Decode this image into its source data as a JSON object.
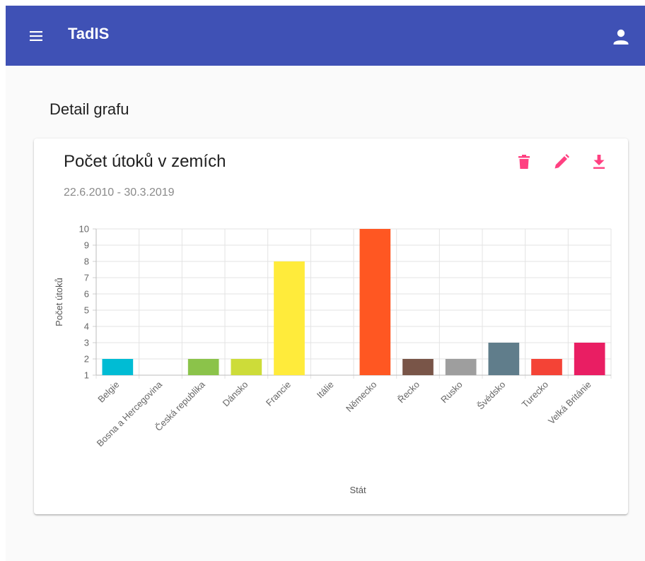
{
  "app": {
    "title": "TadIS",
    "menu_icon": "menu-icon",
    "account_icon": "account-icon",
    "accent_color": "#3f51b5"
  },
  "page": {
    "heading": "Detail grafu"
  },
  "card": {
    "title": "Počet útoků v zemích",
    "subtitle": "22.6.2010 - 30.3.2019",
    "actions": [
      {
        "name": "delete",
        "icon": "trash-icon"
      },
      {
        "name": "edit",
        "icon": "pencil-icon"
      },
      {
        "name": "download",
        "icon": "download-icon"
      }
    ],
    "action_color": "#ff4081"
  },
  "chart_data": {
    "type": "bar",
    "title": "",
    "xlabel": "Stát",
    "ylabel": "Počet útoků",
    "ylim": [
      1,
      10
    ],
    "yticks": [
      1,
      2,
      3,
      4,
      5,
      6,
      7,
      8,
      9,
      10
    ],
    "grid": true,
    "legend": "none",
    "categories": [
      "Belgie",
      "Bosna a Hercegovina",
      "Česká republika",
      "Dánsko",
      "Francie",
      "Itálie",
      "Německo",
      "Řecko",
      "Rusko",
      "Švédsko",
      "Turecko",
      "Velká Británie"
    ],
    "values": [
      2,
      1,
      2,
      2,
      8,
      1,
      10,
      2,
      2,
      3,
      2,
      3
    ],
    "colors": [
      "#00bcd4",
      "#ffffff",
      "#8bc34a",
      "#cddc39",
      "#ffeb3b",
      "#ffffff",
      "#ff5722",
      "#795548",
      "#9e9e9e",
      "#607d8b",
      "#f44336",
      "#e91e63"
    ]
  }
}
